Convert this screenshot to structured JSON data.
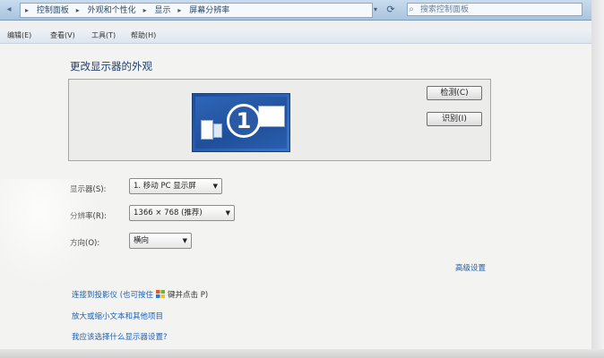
{
  "address_bar": {
    "crumbs": [
      "控制面板",
      "外观和个性化",
      "显示",
      "屏幕分辨率"
    ],
    "search_placeholder": "搜索控制面板"
  },
  "menu": {
    "items": [
      "编辑(E)",
      "查看(V)",
      "工具(T)",
      "帮助(H)"
    ]
  },
  "main": {
    "title": "更改显示器的外观",
    "monitor_number": "1",
    "detect_button": "检测(C)",
    "identify_button": "识别(I)",
    "display_label": "显示器(S):",
    "display_value": "1. 移动 PC 显示屏",
    "resolution_label": "分辨率(R):",
    "resolution_value": "1366 × 768 (推荐)",
    "orientation_label": "方向(O):",
    "orientation_value": "横向",
    "advanced_link": "高级设置",
    "links": {
      "projector_prefix": "连接到投影仪 (也可按住",
      "projector_suffix": "键并点击 P)",
      "text_size": "放大或缩小文本和其他项目",
      "help": "我应该选择什么显示器设置?"
    }
  },
  "colors": {
    "link": "#1c5fb8",
    "title": "#1e3f6e",
    "monitor_blue": "#2a5aa6"
  }
}
